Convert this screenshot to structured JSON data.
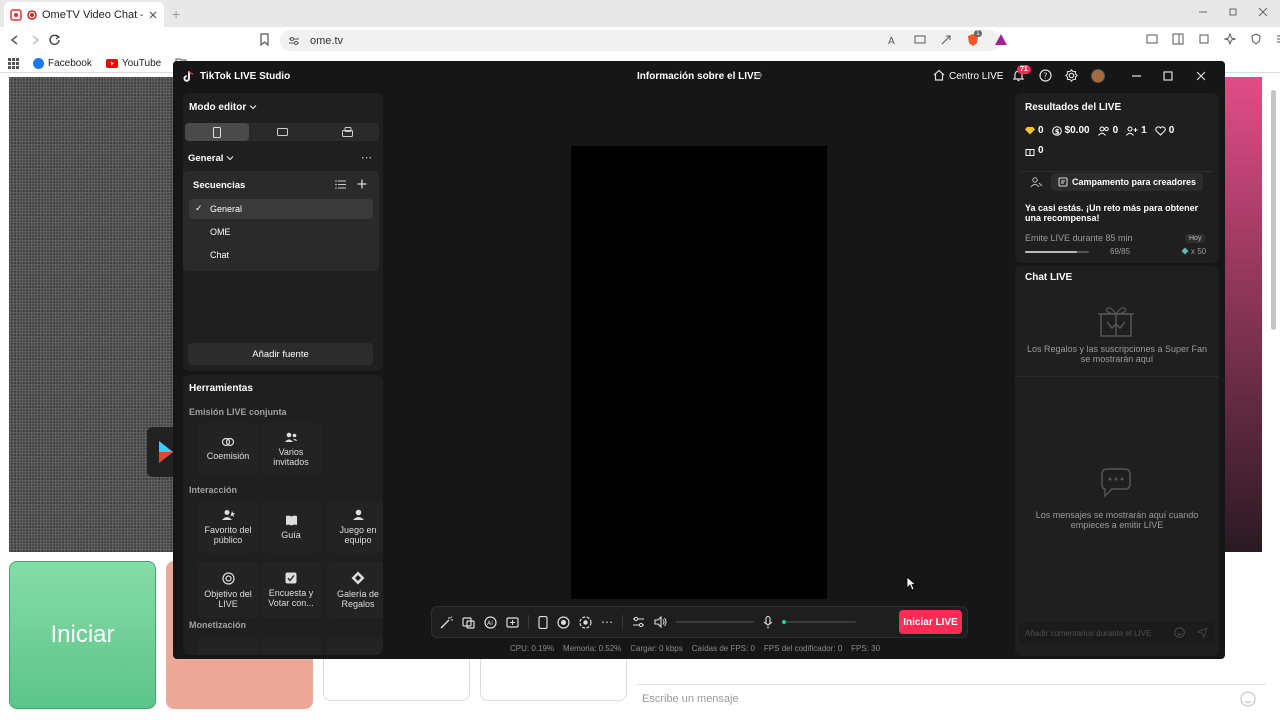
{
  "browser": {
    "tab_title": "OmeTV Video Chat — Omeg",
    "url": "ome.tv",
    "bookmarks": [
      "Facebook",
      "YouTube"
    ],
    "shield_badge": "1",
    "new_tab_symbol": "+"
  },
  "page": {
    "start_button": "Iniciar",
    "message_placeholder": "Escribe un mensaje"
  },
  "studio": {
    "app_title": "TikTok LIVE Studio",
    "center_title": "Información sobre el LIVE",
    "live_center": "Centro LIVE",
    "notif_count": "71",
    "editor_mode": "Modo editor",
    "scene_group": "General",
    "sequences_label": "Secuencias",
    "sequences": [
      {
        "label": "General",
        "check": "✓"
      },
      {
        "label": "OME",
        "check": ""
      },
      {
        "label": "Chat",
        "check": ""
      }
    ],
    "add_source": "Añadir fuente",
    "tools_title": "Herramientas",
    "section_collab": "Emisión LIVE conjunta",
    "collab_tools": [
      "Coemisión",
      "Varios invitados"
    ],
    "section_interaction": "Interacción",
    "interaction_tools": [
      "Favorito del público",
      "Guía",
      "Juego en equipo",
      "Objetivo del LIVE",
      "Encuesta y Votar con...",
      "Galería de Regalos"
    ],
    "section_monetization": "Monetización",
    "start_live": "Iniciar LIVE",
    "status": {
      "cpu": "CPU:  0.19%",
      "memory": "Memoria:  0.52%",
      "load": "Cargar:  0 kbps",
      "fps_drops": "Caídas de FPS:  0",
      "encoder_fps": "FPS del codificador:  0",
      "fps": "FPS:  30"
    },
    "results": {
      "title": "Resultados del LIVE",
      "diamonds": "0",
      "money": "$0.00",
      "viewers": "0",
      "followers": "1",
      "likes": "0",
      "gifts": "0",
      "camp_button": "Campamento para creadores",
      "challenge_text": "Ya casi estás. ¡Un reto más para obtener una recompensa!",
      "task": "Emite LIVE durante 85 min",
      "task_tag": "Hoy",
      "progress_text": "69/85",
      "progress_value": 0.81,
      "reward": "x 50"
    },
    "chat": {
      "title": "Chat LIVE",
      "gifts_info": "Los Regalos y las suscripciones a Super Fan se mostrarán aquí",
      "messages_info": "Los mensajes se mostrarán aquí cuando empieces a emitir LIVE",
      "comment_placeholder": "Añadir comentarios durante el LIVE"
    }
  },
  "colors": {
    "accent": "#fe2c55",
    "studio_bg": "#161616",
    "panel_bg": "#1f1f1f",
    "start_green": "#6fd39a",
    "salmon": "#eea898"
  }
}
